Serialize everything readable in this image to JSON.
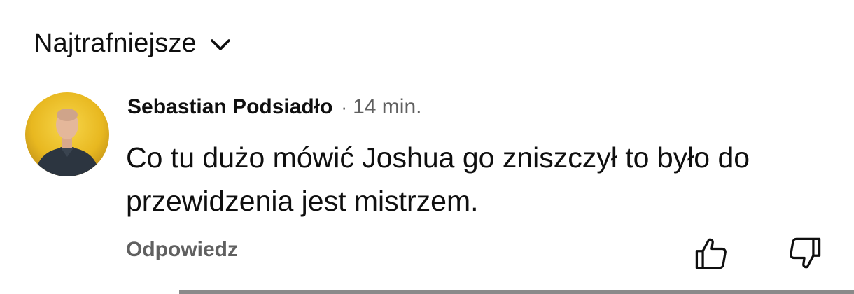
{
  "sort": {
    "label": "Najtrafniejsze",
    "icon": "chevron-down-icon"
  },
  "comment": {
    "author": "Sebastian Podsiadło",
    "separator": "·",
    "time": "14 min.",
    "text": "Co tu dużo mówić Joshua go zniszczył to było do przewidzenia jest mistrzem.",
    "reply_label": "Odpowiedz",
    "avatar": "user-avatar",
    "like_icon": "thumb-up-icon",
    "dislike_icon": "thumb-down-icon"
  },
  "colors": {
    "text_primary": "#0f0f0f",
    "text_secondary": "#606060",
    "avatar_background": "#e8b820"
  }
}
